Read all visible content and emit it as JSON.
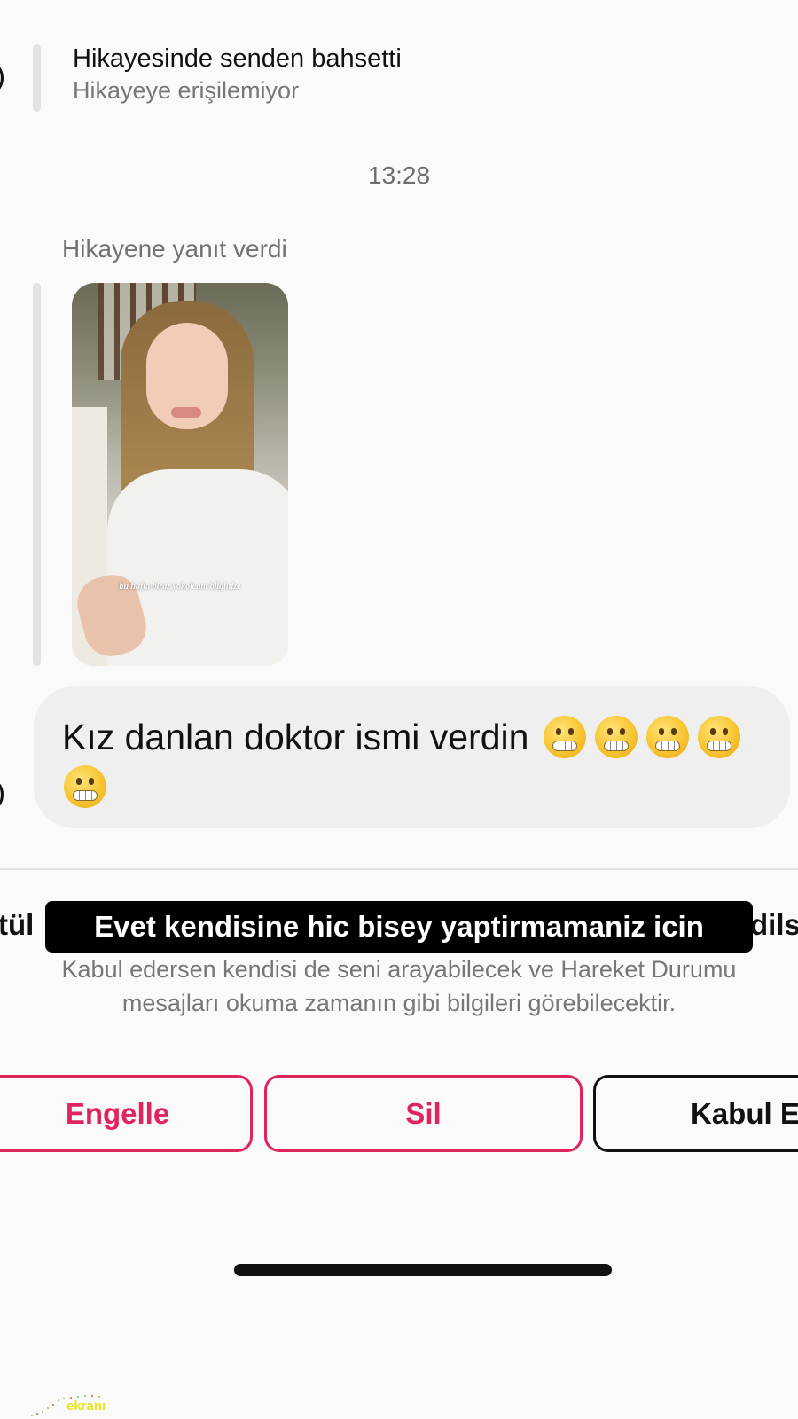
{
  "thread": {
    "mention": {
      "title": "Hikayesinde senden bahsetti",
      "subtitle": "Hikayeye erişilemiyor"
    },
    "timestamp": "13:28",
    "story_reply": {
      "label": "Hikayene yanıt verdi",
      "story_caption": "bu hafta biraz yokolcam bilginize"
    },
    "message": {
      "text": "Kız danlan doktor ismi verdin",
      "emojis": [
        "grimacing-face",
        "grimacing-face",
        "grimacing-face",
        "grimacing-face",
        "grimacing-face"
      ]
    }
  },
  "request_panel": {
    "title_left_fragment": "tül",
    "title_right_fragment": "dils",
    "overlay_caption": "Evet kendisine hic bisey yaptirmamaniz icin",
    "info_line1": "Kabul edersen kendisi de seni arayabilecek ve Hareket Durumu",
    "info_line2": "mesajları okuma zamanın gibi bilgileri görebilecektir.",
    "buttons": {
      "block": "Engelle",
      "delete": "Sil",
      "accept": "Kabul E"
    }
  },
  "watermark": "ekranı",
  "colors": {
    "background": "#fafafa",
    "bubble": "#efefef",
    "danger": "#e0245e",
    "text": "#111111",
    "secondary_text": "#777777"
  }
}
